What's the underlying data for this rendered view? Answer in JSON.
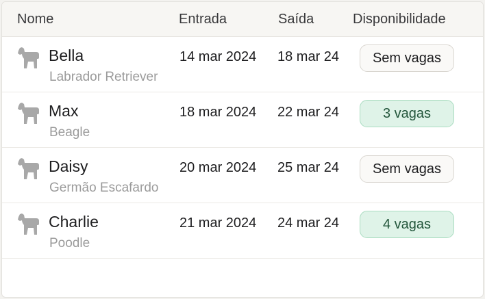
{
  "table": {
    "columns": {
      "name": "Nome",
      "checkin": "Entrada",
      "checkout": "Saída",
      "availability": "Disponibilidade"
    },
    "rows": [
      {
        "name": "Bella",
        "breed": "Labrador Retriever",
        "checkin": "14 mar 2024",
        "checkout": "18 mar 24",
        "availability": "Sem vagas",
        "status": "full"
      },
      {
        "name": "Max",
        "breed": "Beagle",
        "checkin": "18 mar 2024",
        "checkout": "22 mar 24",
        "availability": "3 vagas",
        "status": "available"
      },
      {
        "name": "Daisy",
        "breed": "Germão Escafardo",
        "checkin": "20 mar 2024",
        "checkout": "25 mar 24",
        "availability": "Sem vagas",
        "status": "full"
      },
      {
        "name": "Charlie",
        "breed": "Poodle",
        "checkin": "21 mar 2024",
        "checkout": "24 mar 24",
        "availability": "4 vagas",
        "status": "available"
      }
    ],
    "row_icon": "dog-icon"
  },
  "colors": {
    "available_bg": "#dff3e8",
    "available_border": "#a9dcc0",
    "full_bg": "#faf9f7",
    "icon": "#a8a8a8"
  }
}
